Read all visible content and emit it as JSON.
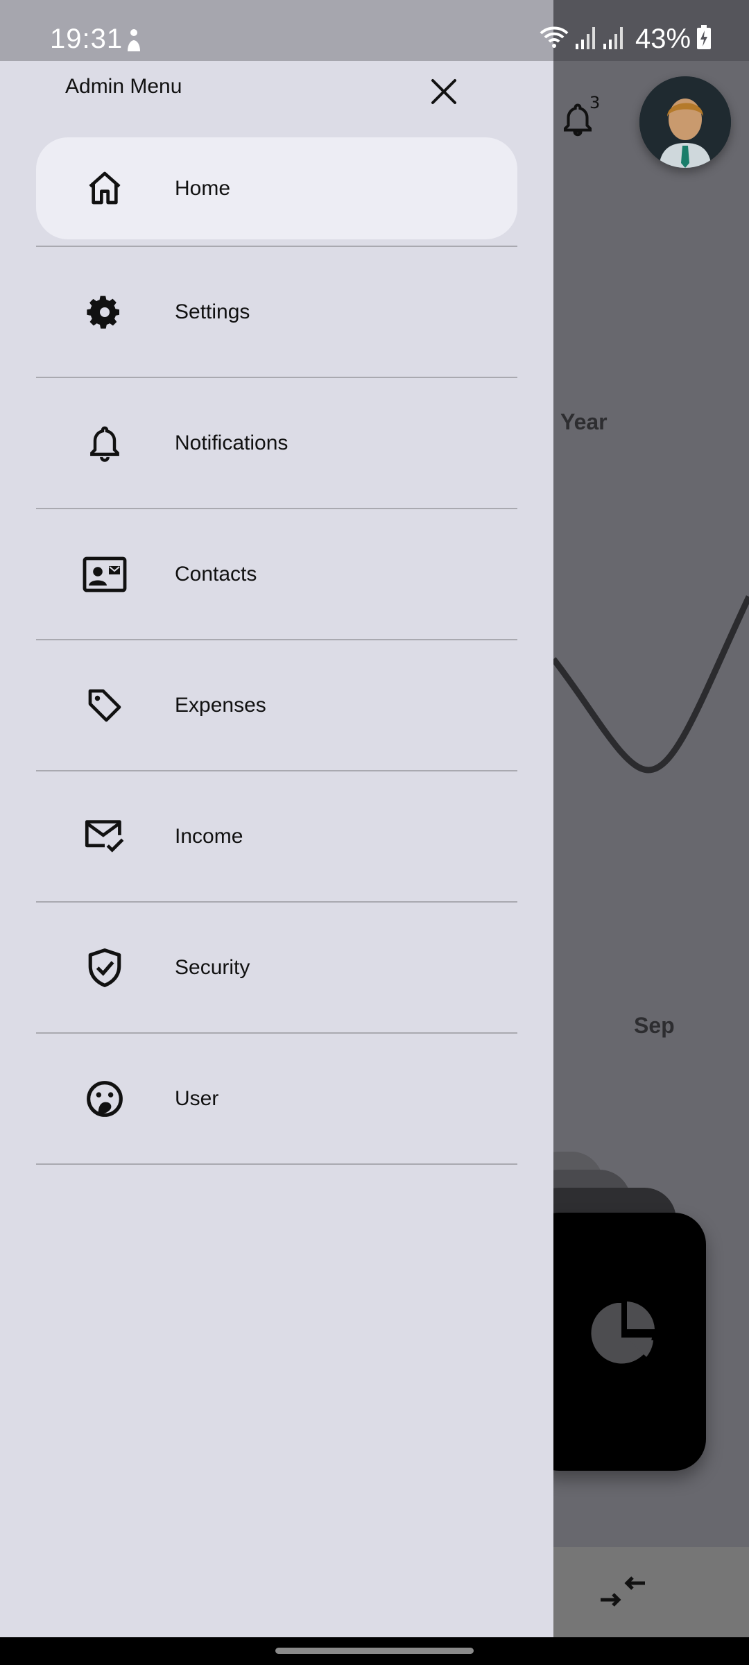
{
  "status_bar": {
    "time": "19:31",
    "battery_percent": "43%"
  },
  "drawer": {
    "title": "Admin Menu",
    "items": [
      {
        "label": "Home",
        "icon": "home-icon",
        "active": true
      },
      {
        "label": "Settings",
        "icon": "gear-icon",
        "active": false
      },
      {
        "label": "Notifications",
        "icon": "bell-icon",
        "active": false
      },
      {
        "label": "Contacts",
        "icon": "contact-card-icon",
        "active": false
      },
      {
        "label": "Expenses",
        "icon": "tag-icon",
        "active": false
      },
      {
        "label": "Income",
        "icon": "mail-check-icon",
        "active": false
      },
      {
        "label": "Security",
        "icon": "shield-check-icon",
        "active": false
      },
      {
        "label": "User",
        "icon": "user-face-icon",
        "active": false
      }
    ]
  },
  "background": {
    "notification_count": "3",
    "year_label": "Year",
    "sep_label": "Sep"
  },
  "colors": {
    "drawer_bg": "#dcdce6",
    "active_item_bg": "#ededf4",
    "scrim": "#68686e"
  }
}
